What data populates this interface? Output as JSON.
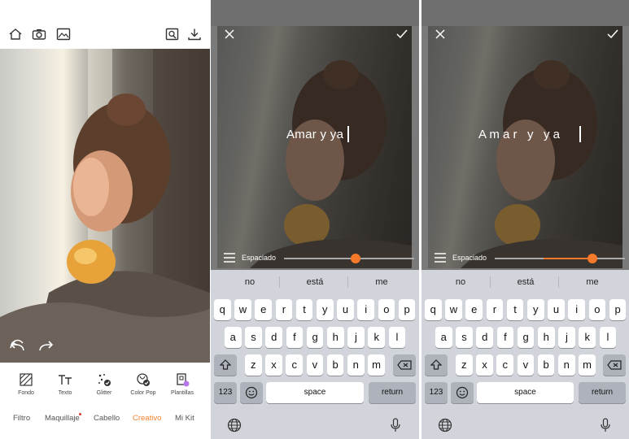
{
  "panel1": {
    "tools": [
      {
        "label": "Fondo",
        "icon": "background-icon"
      },
      {
        "label": "Texto",
        "icon": "text-icon"
      },
      {
        "label": "Glitter",
        "icon": "glitter-icon"
      },
      {
        "label": "Color Pop",
        "icon": "color-pop-icon"
      },
      {
        "label": "Plantillas",
        "icon": "templates-icon"
      }
    ],
    "categories": [
      {
        "label": "Filtro",
        "active": false
      },
      {
        "label": "Maquillaje",
        "active": false
      },
      {
        "label": "Cabello",
        "active": false
      },
      {
        "label": "Creativo",
        "active": true
      },
      {
        "label": "Mi Kit",
        "active": false
      }
    ]
  },
  "editor_left": {
    "text": "Amar y ya",
    "slider_label": "Espaciado",
    "slider_value": 0.55
  },
  "editor_right": {
    "text": "A m a r   y   y a",
    "slider_label": "Espaciado",
    "slider_value": 0.75
  },
  "keyboard": {
    "suggestions": [
      "no",
      "está",
      "me"
    ],
    "row1": [
      "q",
      "w",
      "e",
      "r",
      "t",
      "y",
      "u",
      "i",
      "o",
      "p"
    ],
    "row2": [
      "a",
      "s",
      "d",
      "f",
      "g",
      "h",
      "j",
      "k",
      "l"
    ],
    "row3": [
      "z",
      "x",
      "c",
      "v",
      "b",
      "n",
      "m"
    ],
    "numbers_label": "123",
    "space_label": "space",
    "return_label": "return"
  },
  "colors": {
    "accent": "#f47a2a",
    "active_category": "#f5812d"
  }
}
